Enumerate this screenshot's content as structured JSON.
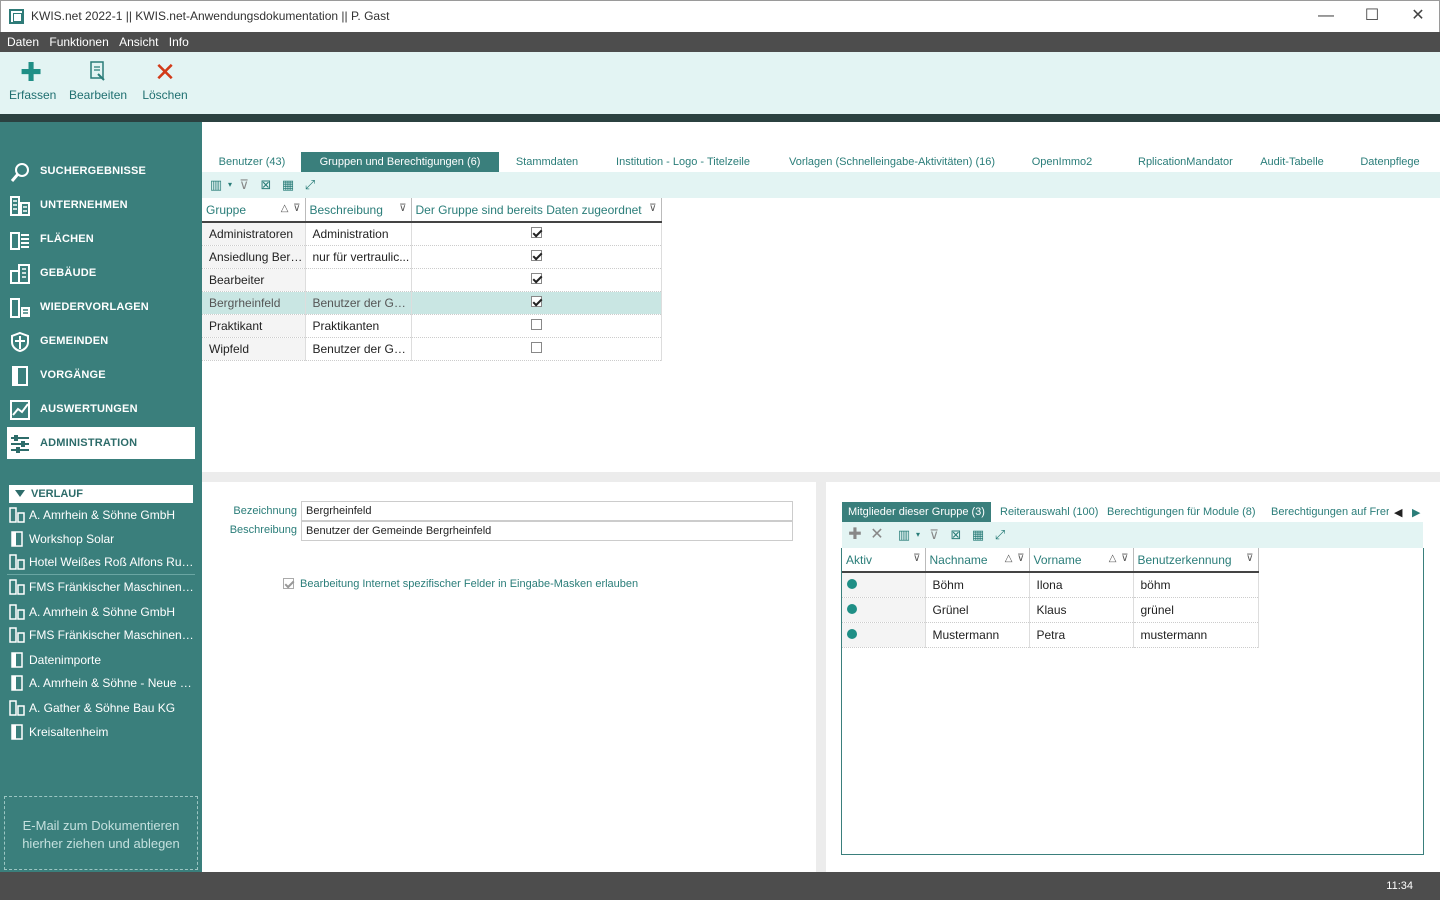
{
  "window": {
    "title": "KWIS.net 2022-1 || KWIS.net-Anwendungsdokumentation || P. Gast"
  },
  "menu": [
    "Daten",
    "Funktionen",
    "Ansicht",
    "Info"
  ],
  "ribbon": {
    "erfassen": "Erfassen",
    "bearbeiten": "Bearbeiten",
    "loeschen": "Löschen"
  },
  "colors": {
    "accent": "#3a7f7c",
    "ribbon_bg": "#e3f4f3",
    "delete": "#d23a18"
  },
  "sidebar": {
    "nav": [
      {
        "label": "SUCHERGEBNISSE",
        "icon": "search-icon"
      },
      {
        "label": "UNTERNEHMEN",
        "icon": "building-icon"
      },
      {
        "label": "FLÄCHEN",
        "icon": "area-icon"
      },
      {
        "label": "GEBÄUDE",
        "icon": "buildings-icon"
      },
      {
        "label": "WIEDERVORLAGEN",
        "icon": "calendar-building-icon"
      },
      {
        "label": "GEMEINDEN",
        "icon": "shield-icon"
      },
      {
        "label": "VORGÄNGE",
        "icon": "document-icon"
      },
      {
        "label": "AUSWERTUNGEN",
        "icon": "chart-icon"
      },
      {
        "label": "ADMINISTRATION",
        "icon": "sliders-icon"
      }
    ],
    "verlauf_label": "VERLAUF",
    "history": [
      "A. Amrhein & Söhne GmbH",
      "Workshop Solar",
      "Hotel Weißes Roß Alfons Rudl...",
      "FMS Fränkischer Maschinen- u...",
      "A. Amrhein & Söhne GmbH",
      "FMS Fränkischer Maschinen- u...",
      "Datenimporte",
      "A. Amrhein & Söhne - Neue Pr...",
      "A. Gather & Söhne Bau KG",
      "Kreisaltenheim"
    ],
    "dropzone_line1": "E-Mail  zum Dokumentieren",
    "dropzone_line2": "hierher ziehen und ablegen"
  },
  "tabs": [
    "Benutzer (43)",
    "Gruppen und Berechtigungen (6)",
    "Stammdaten",
    "Institution - Logo - Titelzeile",
    "Vorlagen (Schnelleingabe-Aktivitäten) (16)",
    "OpenImmo2",
    "RplicationMandator",
    "Audit-Tabelle",
    "Datenpflege"
  ],
  "groups_grid": {
    "columns": [
      "Gruppe",
      "Beschreibung",
      "Der Gruppe sind bereits Daten zugeordnet"
    ],
    "rows": [
      {
        "gruppe": "Administratoren",
        "beschreibung": "Administration",
        "assigned": true
      },
      {
        "gruppe": "Ansiedlung Berg...",
        "beschreibung": "nur für vertraulic...",
        "assigned": true
      },
      {
        "gruppe": "Bearbeiter",
        "beschreibung": "",
        "assigned": true
      },
      {
        "gruppe": "Bergrheinfeld",
        "beschreibung": "Benutzer der Ge...",
        "assigned": true
      },
      {
        "gruppe": "Praktikant",
        "beschreibung": "Praktikanten",
        "assigned": false
      },
      {
        "gruppe": "Wipfeld",
        "beschreibung": "Benutzer der Ge...",
        "assigned": false
      }
    ],
    "selected_index": 3
  },
  "detail": {
    "bezeichnung_label": "Bezeichnung",
    "bezeichnung_value": "Bergrheinfeld",
    "beschreibung_label": "Beschreibung",
    "beschreibung_value": "Benutzer der Gemeinde Bergrheinfeld",
    "internet_checkbox_label": "Bearbeitung Internet spezifischer Felder in Eingabe-Masken erlauben",
    "internet_checked": true
  },
  "member_tabs": [
    "Mitglieder dieser Gruppe (3)",
    "Reiterauswahl (100)",
    "Berechtigungen für Module (8)",
    "Berechtigungen auf Frer"
  ],
  "members_grid": {
    "columns": [
      "Aktiv",
      "Nachname",
      "Vorname",
      "Benutzerkennung"
    ],
    "rows": [
      {
        "nachname": "Böhm",
        "vorname": "Ilona",
        "kennung": "böhm"
      },
      {
        "nachname": "Grünel",
        "vorname": "Klaus",
        "kennung": "grünel"
      },
      {
        "nachname": "Mustermann",
        "vorname": "Petra",
        "kennung": "mustermann"
      }
    ]
  },
  "status": {
    "time": "11:34"
  }
}
